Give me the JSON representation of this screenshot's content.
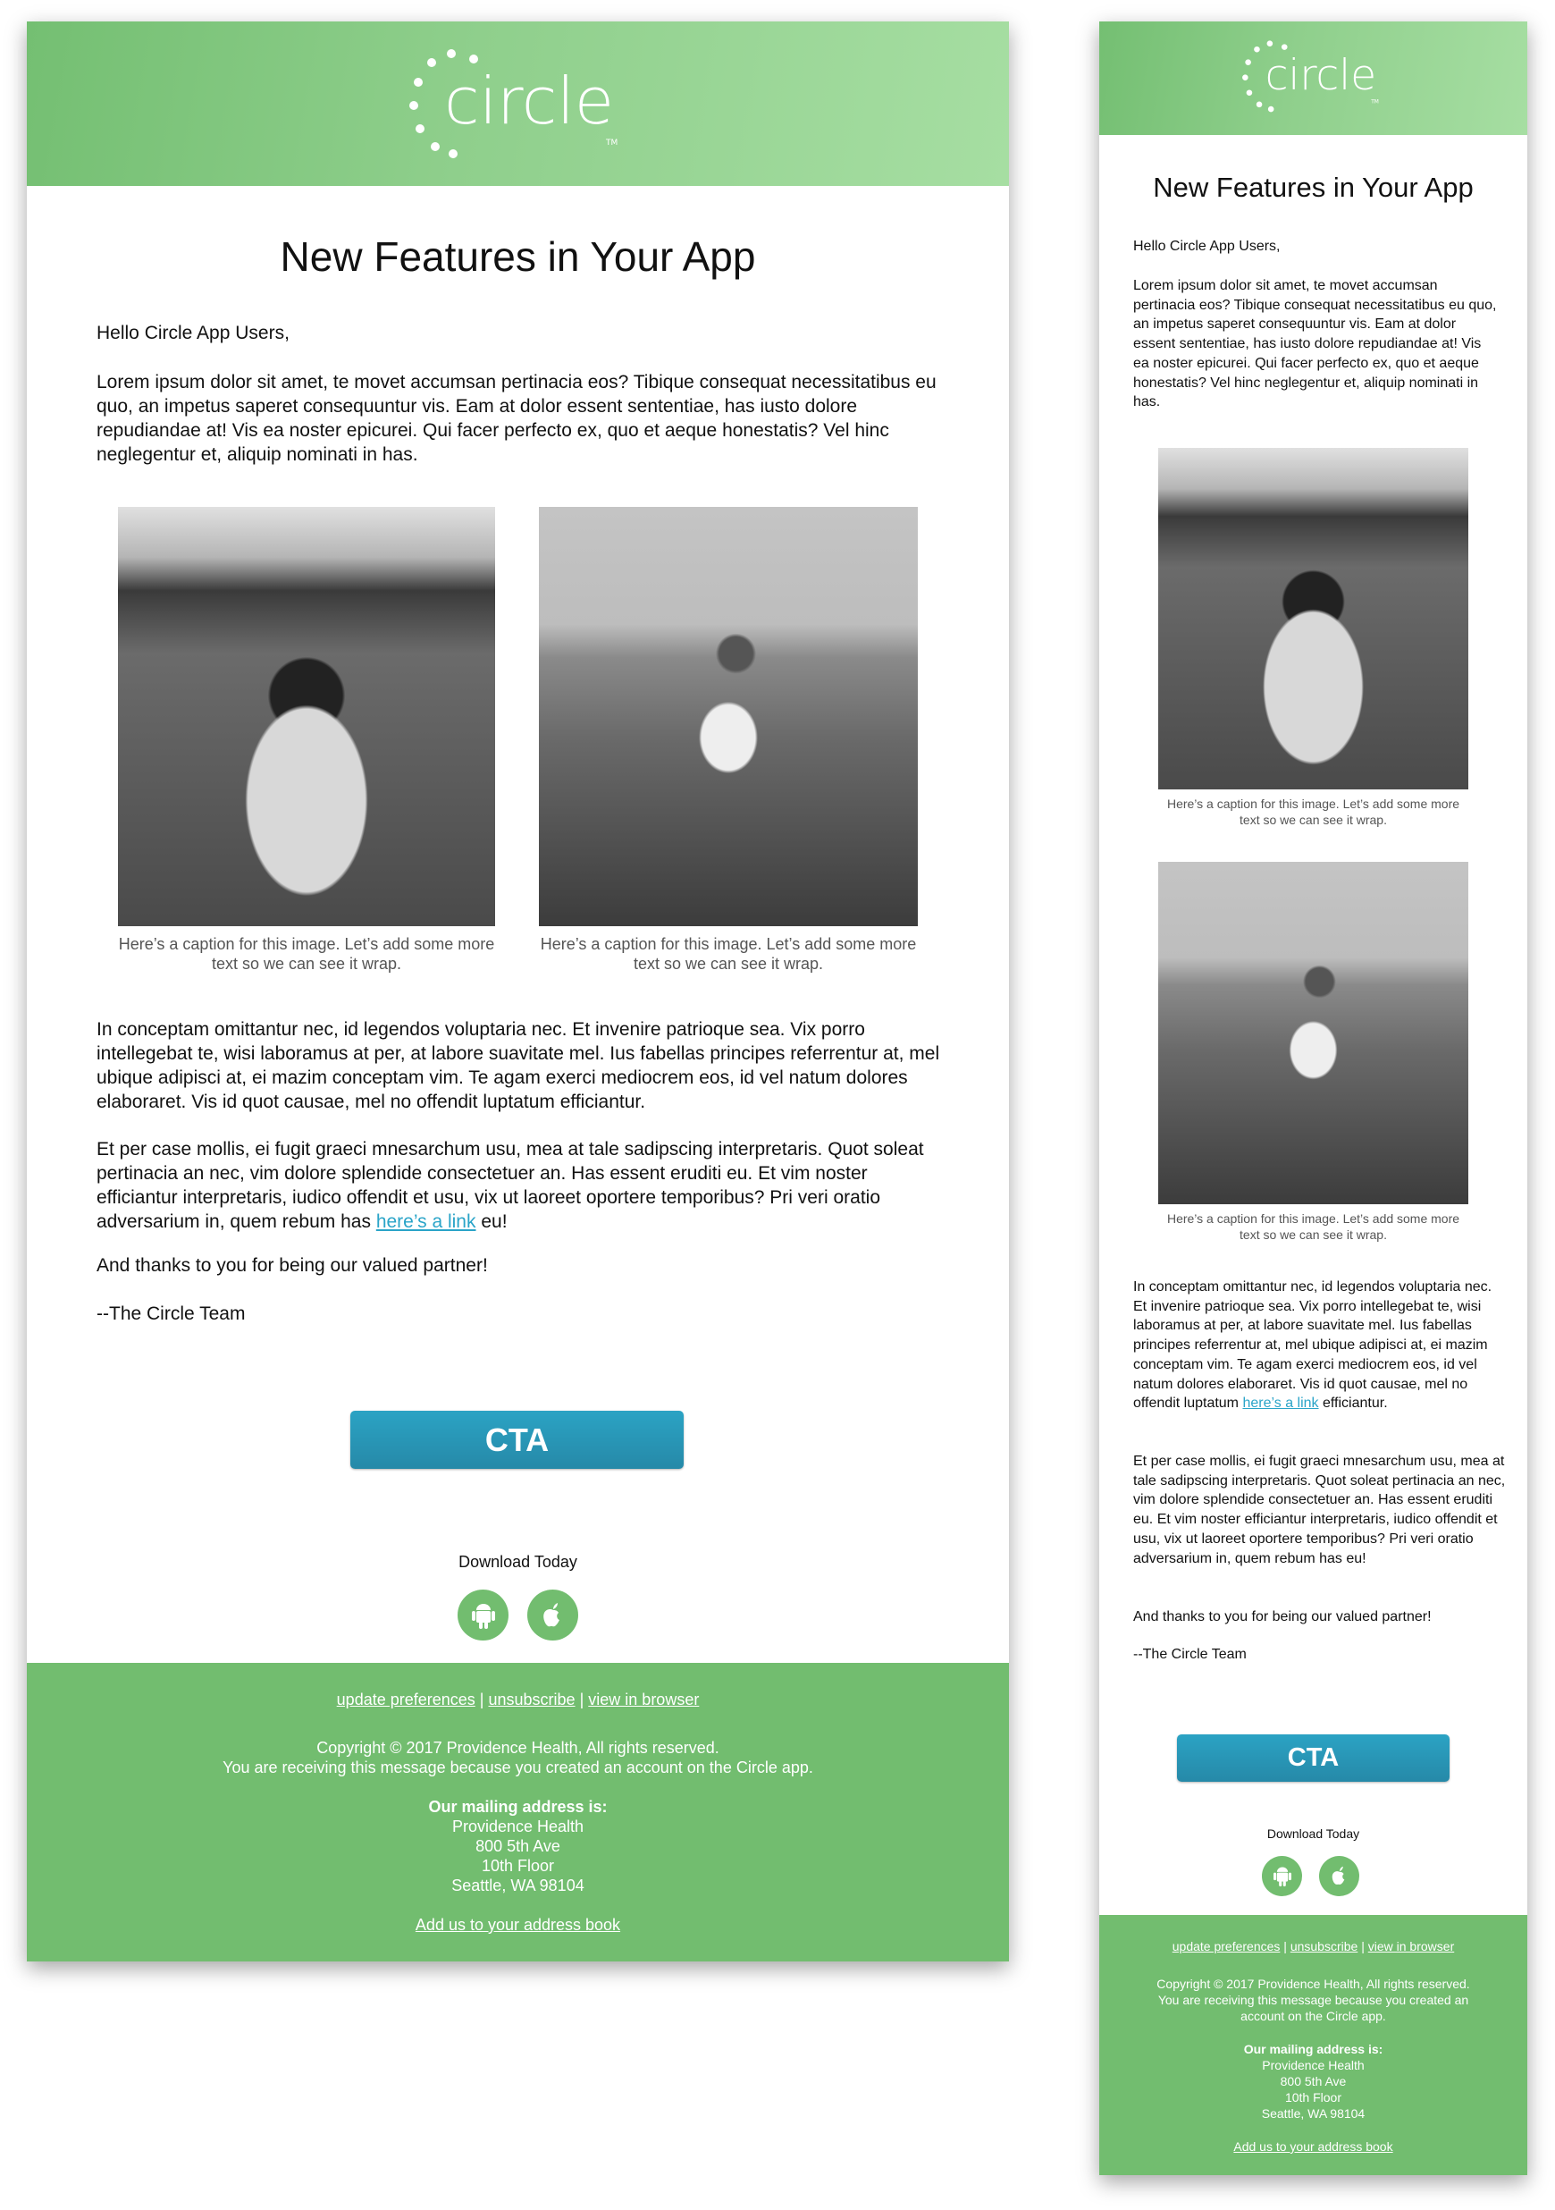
{
  "brand": {
    "logo_text": "circle",
    "trademark": "TM",
    "header_color": "#74bf72",
    "footer_color": "#72bd6f",
    "cta_color": "#2a9bbb",
    "link_color": "#2aa4c8"
  },
  "desktop": {
    "title": "New Features in Your App",
    "greeting": "Hello Circle App Users,",
    "para1": "Lorem ipsum dolor sit amet, te movet accumsan pertinacia eos? Tibique consequat necessitatibus eu quo, an impetus saperet consequuntur vis. Eam at dolor essent sententiae, has iusto dolore repudiandae at! Vis ea noster epicurei. Qui facer perfecto ex, quo et aeque honestatis? Vel hinc neglegentur et, aliquip nominati in has.",
    "images": [
      {
        "caption": "Here’s a caption for this image. Let’s add some more text so we can see it wrap."
      },
      {
        "caption": "Here’s a caption for this image. Let’s add some more text so we can see it wrap."
      }
    ],
    "para2": "In conceptam omittantur nec, id legendos voluptaria nec. Et invenire patrioque sea. Vix porro intellegebat te, wisi laboramus at per, at labore suavitate mel. Ius fabellas principes referrentur at, mel ubique adipisci at, ei mazim conceptam vim. Te agam exerci mediocrem eos, id vel natum dolores elaboraret. Vis id quot causae, mel no offendit luptatum efficiantur.",
    "para3_before": "Et per case mollis, ei fugit graeci mnesarchum usu, mea at tale sadipscing interpretaris. Quot soleat pertinacia an nec, vim dolore splendide consectetuer an. Has essent eruditi eu. Et vim noster efficiantur interpretaris, iudico offendit et usu, vix ut laoreet oportere temporibus? Pri veri oratio adversarium in, quem rebum has ",
    "para3_link": "here’s a link",
    "para3_after": " eu!",
    "thanks": "And thanks to you for being our valued partner!",
    "signoff": "--The Circle Team",
    "cta": "CTA",
    "download": "Download Today"
  },
  "mobile": {
    "title": "New Features in Your App",
    "greeting": "Hello Circle App Users,",
    "para1": "Lorem ipsum dolor sit amet, te movet accumsan pertinacia eos? Tibique consequat necessitatibus eu quo, an impetus saperet consequuntur vis. Eam at dolor essent sententiae, has iusto dolore repudiandae at! Vis ea noster epicurei. Qui facer perfecto ex, quo et aeque honestatis? Vel hinc neglegentur et, aliquip nominati in has.",
    "images": [
      {
        "caption": "Here’s a caption for this image. Let’s add some more text so we can see it wrap."
      },
      {
        "caption": "Here’s a caption for this image. Let’s add some more text so we can see it wrap."
      }
    ],
    "para2_before": "In conceptam omittantur nec, id legendos voluptaria nec. Et invenire patrioque sea. Vix porro intellegebat te, wisi laboramus at per, at labore suavitate mel. Ius fabellas principes referrentur at, mel ubique adipisci at, ei mazim conceptam vim. Te agam exerci mediocrem eos, id vel natum dolores elaboraret. Vis id quot causae, mel no offendit luptatum ",
    "para2_link": "here’s a link",
    "para2_after": " efficiantur.",
    "para3": "Et per case mollis, ei fugit graeci mnesarchum usu, mea at tale sadipscing interpretaris. Quot soleat pertinacia an nec, vim dolore splendide consectetuer an. Has essent eruditi eu. Et vim noster efficiantur interpretaris, iudico offendit et usu, vix ut laoreet oportere temporibus? Pri veri oratio adversarium in, quem rebum has eu!",
    "thanks": "And thanks to you for being our valued partner!",
    "signoff": "--The Circle Team",
    "cta": "CTA",
    "download": "Download Today"
  },
  "footer": {
    "links": [
      "update preferences",
      "unsubscribe",
      "view in browser"
    ],
    "separator": "|",
    "copyright": "Copyright © 2017 Providence Health, All rights reserved.",
    "reason": "You are receiving this message because you created an account on the Circle app.",
    "address_label": "Our mailing address is:",
    "address": [
      "Providence Health",
      "800 5th Ave",
      "10th Floor",
      "Seattle, WA 98104"
    ],
    "address_book": "Add us to your address book"
  },
  "icons": {
    "android": "android-icon",
    "apple": "apple-icon"
  }
}
